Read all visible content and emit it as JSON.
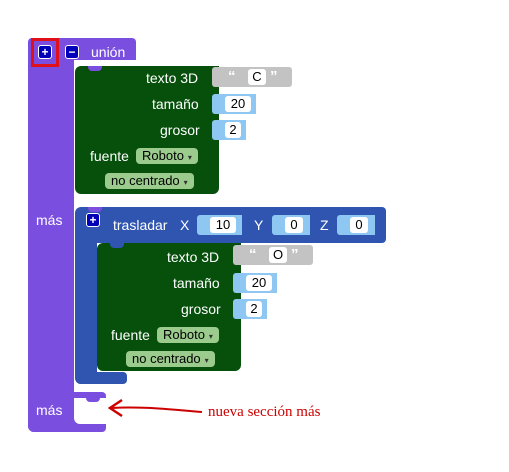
{
  "union": {
    "label": "unión",
    "add_button": "+",
    "remove_button": "−",
    "mas_label_1": "más",
    "mas_label_2": "más"
  },
  "text3d_1": {
    "label": "texto 3D",
    "text_value": "C",
    "open_quote": "“",
    "close_quote": "”",
    "size_label": "tamaño",
    "size_value": "20",
    "thickness_label": "grosor",
    "thickness_value": "2",
    "font_label": "fuente",
    "font_value": "Roboto",
    "align_value": "no centrado",
    "caret": "▾"
  },
  "translate": {
    "label": "trasladar",
    "add_button": "+",
    "x_label": "X",
    "x_value": "10",
    "y_label": "Y",
    "y_value": "0",
    "z_label": "Z",
    "z_value": "0"
  },
  "text3d_2": {
    "label": "texto 3D",
    "text_value": "O",
    "open_quote": "“",
    "close_quote": "”",
    "size_label": "tamaño",
    "size_value": "20",
    "thickness_label": "grosor",
    "thickness_value": "2",
    "font_label": "fuente",
    "font_value": "Roboto",
    "align_value": "no centrado",
    "caret": "▾"
  },
  "annotation": {
    "text": "nueva sección más",
    "color": "#cc0000"
  },
  "colors": {
    "union": "#7a4fe0",
    "text3d": "#06500c",
    "translate": "#2f55b0",
    "number_input": "#8ec8f2",
    "dropdown": "#9ccb8e",
    "string": "#c3c3c3"
  }
}
